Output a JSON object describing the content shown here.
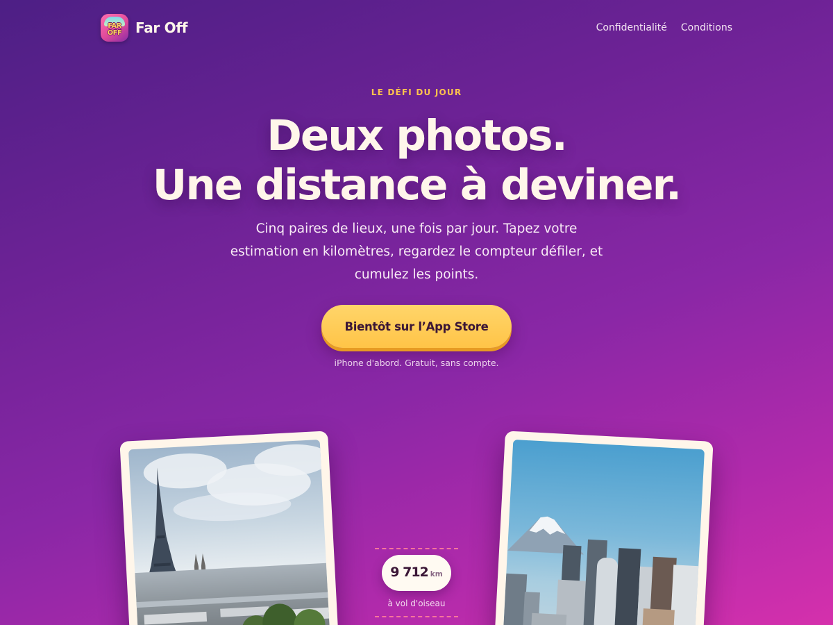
{
  "header": {
    "brand_name": "Far Off",
    "icon_text_1": "FAR",
    "icon_text_2": "OFF",
    "nav": [
      "Confidentialité",
      "Conditions"
    ]
  },
  "hero": {
    "eyebrow": "LE DÉFI DU JOUR",
    "headline_line1": "Deux photos.",
    "headline_line2": "Une distance à deviner.",
    "subtitle": "Cinq paires de lieux, une fois par jour. Tapez votre estimation en kilomètres, regardez le compteur défiler, et cumulez les points.",
    "cta_label": "Bientôt sur l’App Store",
    "cta_note": "iPhone d'abord. Gratuit, sans compte."
  },
  "showcase": {
    "left_photo": "paris-eiffel-tower-photo",
    "right_photo": "tokyo-mount-fuji-photo",
    "distance_value": "9 712",
    "distance_unit": "km",
    "distance_label": "à vol d'oiseau"
  },
  "colors": {
    "accent_yellow": "#ffc447",
    "eyebrow": "#ffc34d",
    "text_cream": "#fff6ea",
    "dash_pink": "#ff7e9a"
  }
}
